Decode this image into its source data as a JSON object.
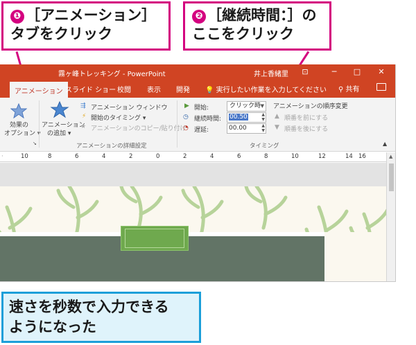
{
  "callouts": {
    "step1": {
      "number": "❶",
      "line1": "［アニメーション］",
      "line2": "タブをクリック"
    },
    "step2": {
      "number": "❷",
      "line1": "［継続時間：］の",
      "line2": "ここをクリック"
    },
    "result": {
      "line1": "速さを秒数で入力できる",
      "line2": "ようになった"
    },
    "accent_color": "#d4007f",
    "result_color": "#1b9fd9"
  },
  "window": {
    "title": "霧ヶ峰トレッキング - PowerPoint",
    "user": "井上香緒里",
    "buttons": {
      "restore": "⊡",
      "minimize": "─",
      "maximize": "□",
      "close": "✕"
    },
    "titlebar_color": "#d04423"
  },
  "tabs": [
    {
      "label": "アニメーション",
      "active": true
    },
    {
      "label": "スライド ショー",
      "active": false
    },
    {
      "label": "校閲",
      "active": false
    },
    {
      "label": "表示",
      "active": false
    },
    {
      "label": "開発",
      "active": false
    }
  ],
  "tellme": "実行したい作業を入力してください",
  "share": "共有",
  "ribbon": {
    "effect_options": {
      "line1": "効果の",
      "line2": "オプション ▾"
    },
    "add_animation": {
      "line1": "アニメーション",
      "line2": "の追加 ▾"
    },
    "animation_pane": "アニメーション ウィンドウ",
    "trigger": "開始のタイミング ▾",
    "animation_painter": "アニメーションのコピー/貼り付け",
    "advanced_group": "アニメーションの詳細設定",
    "start_label": "開始:",
    "start_value": "クリック時",
    "duration_label": "継続時間:",
    "duration_value": "00.50",
    "delay_label": "遅延:",
    "delay_value": "00.00",
    "reorder_title": "アニメーションの順序変更",
    "move_earlier": "順番を前にする",
    "move_later": "順番を後にする",
    "timing_group": "タイミング"
  },
  "ruler_numbers": [
    "10",
    "8",
    "6",
    "4",
    "2",
    "0",
    "2",
    "4",
    "6",
    "8",
    "10",
    "12",
    "14",
    "16"
  ]
}
